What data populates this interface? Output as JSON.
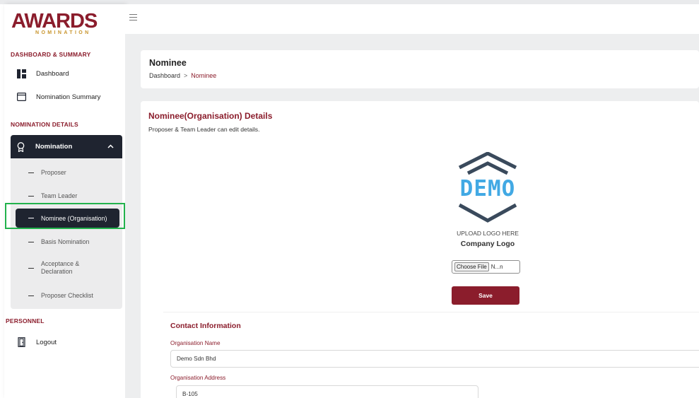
{
  "brand": {
    "logo_main": "AWARDS",
    "logo_sub": "NOMINATION"
  },
  "sidebar": {
    "section_dashboard": "DASHBOARD & SUMMARY",
    "dashboard": "Dashboard",
    "nomination_summary": "Nomination Summary",
    "section_nomination": "NOMINATION DETAILS",
    "nomination_group": "Nomination",
    "sub_items": [
      "Proposer",
      "Team Leader",
      "Nominee (Organisation)",
      "Basis Nomination",
      "Acceptance & Declaration",
      "Proposer Checklist"
    ],
    "section_personnel": "PERSONNEL",
    "logout": "Logout"
  },
  "header": {
    "title": "Nominee",
    "breadcrumb": {
      "root": "Dashboard",
      "separator": ">",
      "current": "Nominee"
    }
  },
  "form": {
    "heading": "Nominee(Organisation) Details",
    "description": "Proposer & Team Leader can edit details.",
    "logo_placeholder": "DEMO",
    "upload_hint": "UPLOAD LOGO HERE",
    "logo_label": "Company Logo",
    "file_button": "Choose File",
    "file_name": "N...n",
    "save": "Save",
    "contact_title": "Contact Information",
    "org_name_label": "Organisation Name",
    "org_name_value": "Demo Sdn Bhd",
    "org_address_label": "Organisation Address",
    "org_address_value": "B-105"
  },
  "colors": {
    "brand": "#8b1d2c",
    "nav_dark": "#1f2430",
    "highlight": "#22b24c",
    "background": "#edeeef"
  }
}
